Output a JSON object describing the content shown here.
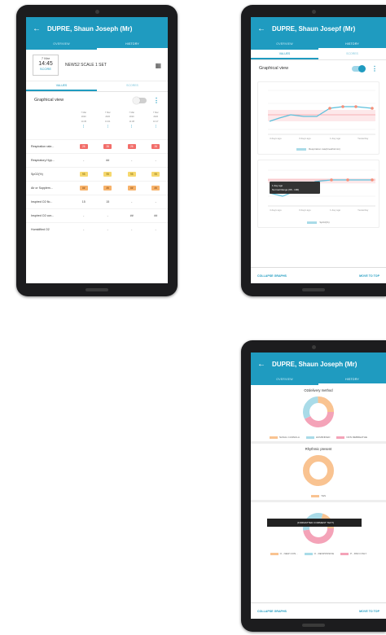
{
  "patient_title": "DUPRE, Shaun Joseph (Mr)",
  "patient_title_alt": "DUPRE, Shaun Josepf (Mr)",
  "tab_overview": "OVERVIEW",
  "tab_history": "HISTORY",
  "subtab_values": "VALUES",
  "subtab_scores": "SCORES",
  "graphical_view": "Graphical view",
  "tablet1": {
    "chart_time": "14:45",
    "chart_date": "7 Mar",
    "chart_sub": "SCORE",
    "chart_title": "NEWS2 SCALE 1 SET",
    "columns": [
      {
        "date": "7 Mar",
        "l2": "2020",
        "l3": "14:45"
      },
      {
        "date": "7 Mar",
        "l2": "2020",
        "l3": "13:21"
      },
      {
        "date": "7 Mar",
        "l2": "2020",
        "l3": "11:38"
      },
      {
        "date": "7 Mar",
        "l2": "2020",
        "l3": "10:17"
      }
    ],
    "rows": [
      {
        "label": "Respiration rate...",
        "cells": [
          {
            "t": "26",
            "c": "red"
          },
          {
            "t": "26",
            "c": "red"
          },
          {
            "t": "26",
            "c": "red"
          },
          {
            "t": "26",
            "c": "red"
          }
        ]
      },
      {
        "label": "Respiratory Hyp...",
        "cells": [
          {
            "t": "-",
            "c": "plain"
          },
          {
            "t": "##",
            "c": "plain"
          },
          {
            "t": "-",
            "c": "plain"
          },
          {
            "t": "-",
            "c": "plain"
          }
        ]
      },
      {
        "label": "SpO2(%)",
        "cells": [
          {
            "t": "95",
            "c": "yellow"
          },
          {
            "t": "95",
            "c": "yellow"
          },
          {
            "t": "95",
            "c": "yellow"
          },
          {
            "t": "95",
            "c": "yellow"
          }
        ]
      },
      {
        "label": "Air or Supplem...",
        "cells": [
          {
            "t": "##",
            "c": "orange"
          },
          {
            "t": "##",
            "c": "orange"
          },
          {
            "t": "##",
            "c": "orange"
          },
          {
            "t": "##",
            "c": "orange"
          }
        ]
      },
      {
        "label": "Inspired O2 flo...",
        "cells": [
          {
            "t": "15",
            "c": "plain"
          },
          {
            "t": "15",
            "c": "plain"
          },
          {
            "t": "-",
            "c": "plain"
          },
          {
            "t": "-",
            "c": "plain"
          }
        ]
      },
      {
        "label": "Inspired O2 con...",
        "cells": [
          {
            "t": "-",
            "c": "plain"
          },
          {
            "t": "-",
            "c": "plain"
          },
          {
            "t": "##",
            "c": "plain"
          },
          {
            "t": "##",
            "c": "plain"
          }
        ]
      },
      {
        "label": "Humidified O2",
        "cells": [
          {
            "t": "-",
            "c": "plain"
          },
          {
            "t": "-",
            "c": "plain"
          },
          {
            "t": "-",
            "c": "plain"
          },
          {
            "t": "-",
            "c": "plain"
          }
        ]
      }
    ]
  },
  "tablet2": {
    "legend1": "Respiration rate(breaths/min)",
    "legend2": "SpO2(%)",
    "xlabels": [
      "4 days ago",
      "3 days ago",
      "1 day ago",
      "Yesterday"
    ],
    "tooltip_line1": "1 day ago",
    "tooltip_line2": "Normal Range (96 - 100)",
    "collapse": "COLLAPSE GRAPHS",
    "move_top": "MOVE TO TOP"
  },
  "tablet3": {
    "donut1_title": "O2delivery method",
    "donut1_legend": [
      "NASAL CANNULA",
      "HUMIDIFIED",
      "NON REBREATHE"
    ],
    "donut2_title": "Rhythmic present",
    "donut2_legend": [
      "YES"
    ],
    "donut3_legend": [
      "O - NEW CON...",
      "O - RESPONSIVE",
      "P - PAIN ONLY"
    ],
    "collapse": "COLLAPSE GRAPHS",
    "move_top": "MOVE TO TOP",
    "tooltip": "(FORMATTED COMMENT TEXT)"
  },
  "colors": {
    "primary": "#1f9bc0",
    "red": "#f26e6a",
    "yellow": "#f6d86e",
    "orange": "#f7b26a",
    "pink": "#f4a3b8",
    "cyan": "#a9dbe8",
    "peach": "#f9c391"
  }
}
